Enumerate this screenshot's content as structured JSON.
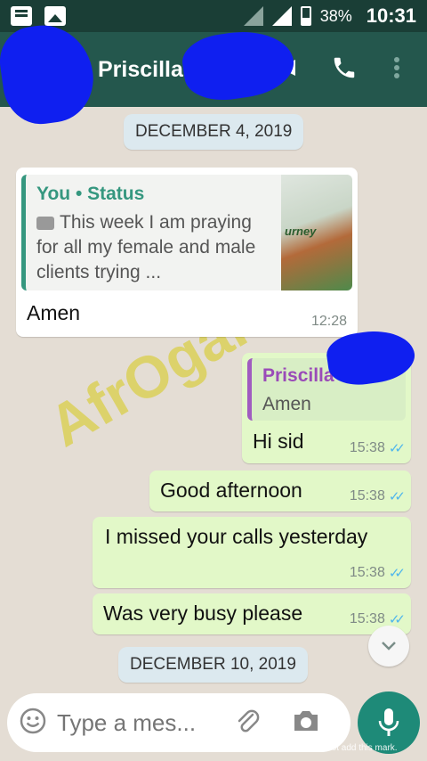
{
  "status_bar": {
    "battery": "38%",
    "time": "10:31"
  },
  "header": {
    "contact_name": "Priscilla"
  },
  "messages": [
    {
      "type": "date",
      "text": "DECEMBER 4, 2019"
    },
    {
      "type": "incoming",
      "quote": {
        "title": "You • Status",
        "text": "This week I am praying for all my female and male clients trying ..."
      },
      "thumbnail_text": "urney",
      "text": "Amen",
      "time": "12:28"
    },
    {
      "type": "outgoing",
      "quote": {
        "title": "Priscilla",
        "text": "Amen"
      },
      "text": "Hi sid",
      "time": "15:38"
    },
    {
      "type": "outgoing",
      "text": "Good afternoon",
      "time": "15:38"
    },
    {
      "type": "outgoing",
      "text": "I missed your calls yesterday",
      "time": "15:38"
    },
    {
      "type": "outgoing",
      "text": "Was very busy please",
      "time": "15:38"
    },
    {
      "type": "date",
      "text": "DECEMBER 10, 2019"
    }
  ],
  "watermark": "AfrOganiks",
  "input": {
    "placeholder": "Type a mes..."
  },
  "footer_note": "Processed using the free version of Watermarkly. The paid version does not add this mark.",
  "colors": {
    "header": "#24574d",
    "status_bar": "#1a3e36",
    "outgoing_bubble": "#e2f8c8",
    "quote_accent": "#35977f",
    "mic_button": "#1e8a78"
  },
  "icons": [
    "message-icon",
    "image-icon",
    "back-arrow-icon",
    "video-call-icon",
    "phone-icon",
    "more-options-icon",
    "camera-icon",
    "emoji-icon",
    "attach-icon",
    "mic-icon",
    "chevron-down-icon"
  ]
}
